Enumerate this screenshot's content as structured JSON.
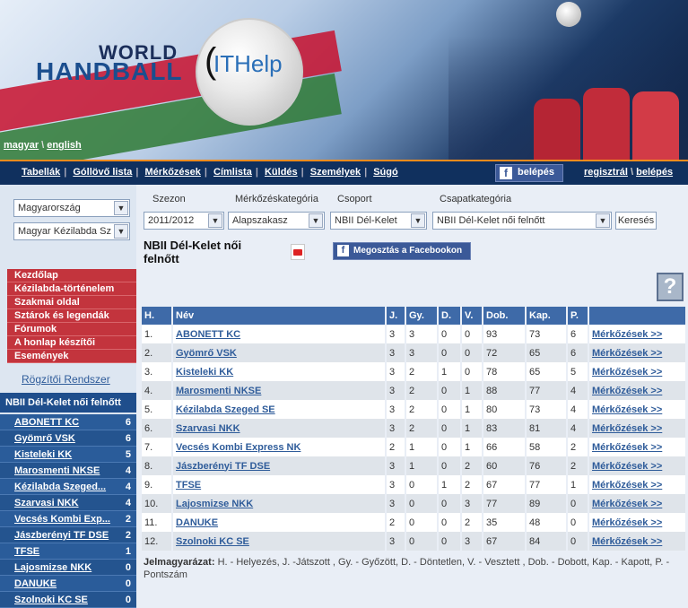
{
  "header": {
    "logo_world": "WORLD",
    "logo_handball": "HANDBALL",
    "logo_ithelp": "ITHelp",
    "lang": {
      "hu": "magyar",
      "sep": "\\",
      "en": "english"
    }
  },
  "nav": {
    "links": [
      "Tabellák",
      "Góllövő lista",
      "Mérkőzések",
      "Címlista",
      "Küldés",
      "Személyek",
      "Súgó"
    ],
    "fb_login": "belépés",
    "register": "regisztrál",
    "sep": "\\",
    "login": "belépés"
  },
  "left": {
    "country": "Magyarország",
    "federation": "Magyar Kézilabda Sz",
    "menu": [
      "Kezdőlap",
      "Kézilabda-történelem",
      "Szakmai oldal",
      "Sztárok és legendák",
      "Fórumok",
      "A honlap készítői",
      "Események"
    ],
    "rogzito": "Rögzítői Rendszer",
    "league_title": "NBII Dél-Kelet női felnőtt",
    "league_rows": [
      {
        "team": "ABONETT KC",
        "pts": "6"
      },
      {
        "team": "Gyömrő VSK",
        "pts": "6"
      },
      {
        "team": "Kisteleki KK",
        "pts": "5"
      },
      {
        "team": "Marosmenti NKSE",
        "pts": "4"
      },
      {
        "team": "Kézilabda Szeged...",
        "pts": "4"
      },
      {
        "team": "Szarvasi NKK",
        "pts": "4"
      },
      {
        "team": "Vecsés Kombi Exp...",
        "pts": "2"
      },
      {
        "team": "Jászberényi TF DSE",
        "pts": "2"
      },
      {
        "team": "TFSE",
        "pts": "1"
      },
      {
        "team": "Lajosmizse NKK",
        "pts": "0"
      },
      {
        "team": "DANUKE",
        "pts": "0"
      },
      {
        "team": "Szolnoki KC SE",
        "pts": "0"
      }
    ]
  },
  "filters": {
    "season_label": "Szezon",
    "season_value": "2011/2012",
    "category_label": "Mérkőzéskategória",
    "category_value": "Alapszakasz",
    "group_label": "Csoport",
    "group_value": "NBII Dél-Kelet",
    "teamcat_label": "Csapatkategória",
    "teamcat_value": "NBII Dél-Kelet női felnőtt",
    "search": "Keresés"
  },
  "main": {
    "title": "NBII Dél-Kelet női felnőtt",
    "fb_share": "Megosztás a Facebookon",
    "help": "?"
  },
  "table": {
    "headers": [
      "H.",
      "Név",
      "J.",
      "Gy.",
      "D.",
      "V.",
      "Dob.",
      "Kap.",
      "P.",
      ""
    ],
    "rows": [
      {
        "h": "1.",
        "name": "ABONETT KC",
        "j": "3",
        "gy": "3",
        "d": "0",
        "v": "0",
        "dob": "93",
        "kap": "73",
        "p": "6",
        "link": "Mérkőzések >>"
      },
      {
        "h": "2.",
        "name": "Gyömrő VSK",
        "j": "3",
        "gy": "3",
        "d": "0",
        "v": "0",
        "dob": "72",
        "kap": "65",
        "p": "6",
        "link": "Mérkőzések >>"
      },
      {
        "h": "3.",
        "name": "Kisteleki KK",
        "j": "3",
        "gy": "2",
        "d": "1",
        "v": "0",
        "dob": "78",
        "kap": "65",
        "p": "5",
        "link": "Mérkőzések >>"
      },
      {
        "h": "4.",
        "name": "Marosmenti NKSE",
        "j": "3",
        "gy": "2",
        "d": "0",
        "v": "1",
        "dob": "88",
        "kap": "77",
        "p": "4",
        "link": "Mérkőzések >>"
      },
      {
        "h": "5.",
        "name": "Kézilabda Szeged SE",
        "j": "3",
        "gy": "2",
        "d": "0",
        "v": "1",
        "dob": "80",
        "kap": "73",
        "p": "4",
        "link": "Mérkőzések >>"
      },
      {
        "h": "6.",
        "name": "Szarvasi NKK",
        "j": "3",
        "gy": "2",
        "d": "0",
        "v": "1",
        "dob": "83",
        "kap": "81",
        "p": "4",
        "link": "Mérkőzések >>"
      },
      {
        "h": "7.",
        "name": "Vecsés Kombi Express NK",
        "j": "2",
        "gy": "1",
        "d": "0",
        "v": "1",
        "dob": "66",
        "kap": "58",
        "p": "2",
        "link": "Mérkőzések >>"
      },
      {
        "h": "8.",
        "name": "Jászberényi TF DSE",
        "j": "3",
        "gy": "1",
        "d": "0",
        "v": "2",
        "dob": "60",
        "kap": "76",
        "p": "2",
        "link": "Mérkőzések >>"
      },
      {
        "h": "9.",
        "name": "TFSE",
        "j": "3",
        "gy": "0",
        "d": "1",
        "v": "2",
        "dob": "67",
        "kap": "77",
        "p": "1",
        "link": "Mérkőzések >>"
      },
      {
        "h": "10.",
        "name": "Lajosmizse NKK",
        "j": "3",
        "gy": "0",
        "d": "0",
        "v": "3",
        "dob": "77",
        "kap": "89",
        "p": "0",
        "link": "Mérkőzések >>"
      },
      {
        "h": "11.",
        "name": "DANUKE",
        "j": "2",
        "gy": "0",
        "d": "0",
        "v": "2",
        "dob": "35",
        "kap": "48",
        "p": "0",
        "link": "Mérkőzések >>"
      },
      {
        "h": "12.",
        "name": "Szolnoki KC SE",
        "j": "3",
        "gy": "0",
        "d": "0",
        "v": "3",
        "dob": "67",
        "kap": "84",
        "p": "0",
        "link": "Mérkőzések >>"
      }
    ]
  },
  "legend": {
    "label": "Jelmagyarázat:",
    "text": "H. - Helyezés, J. -Játszott , Gy. - Győzött, D. - Döntetlen, V. - Vesztett , Dob. - Dobott, Kap. - Kapott, P. - Pontszám"
  }
}
